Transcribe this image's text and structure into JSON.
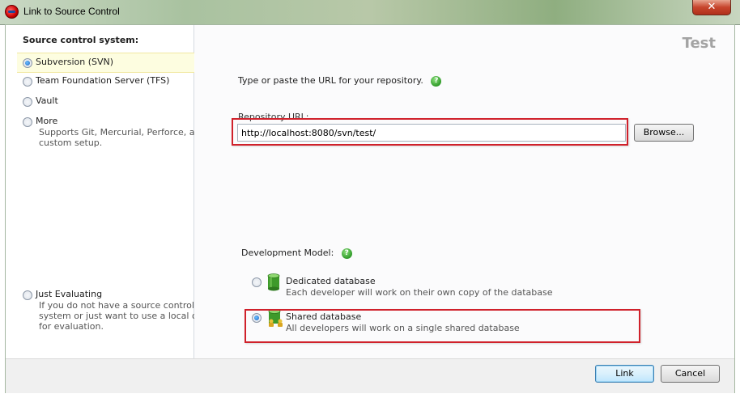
{
  "window": {
    "title": "Link to Source Control",
    "close_label": "✕"
  },
  "left": {
    "heading": "Source control system:",
    "options": [
      {
        "label": "Subversion (SVN)",
        "selected": true
      },
      {
        "label": "Team Foundation Server (TFS)",
        "selected": false
      },
      {
        "label": "Vault",
        "selected": false
      },
      {
        "label": "More",
        "desc_lines": [
          "Supports Git, Mercurial, Perforce, and",
          "custom setup."
        ],
        "selected": false
      },
      {
        "label": "Just Evaluating",
        "desc_lines": [
          "If you do not have a source control",
          "system or just want to use a local one",
          "for evaluation."
        ],
        "selected": false
      }
    ]
  },
  "right": {
    "page_title": "Test",
    "instruction": "Type or paste the URL for your repository.",
    "repo_label": "Repository URL:",
    "repo_url": "http://localhost:8080/svn/test/",
    "browse_label": "Browse...",
    "dev_model_label": "Development Model:",
    "models": [
      {
        "title": "Dedicated database",
        "desc": "Each developer will work on their own copy of the database",
        "selected": false
      },
      {
        "title": "Shared database",
        "desc": "All developers will work on a single shared database",
        "selected": true
      }
    ]
  },
  "footer": {
    "link_label": "Link",
    "cancel_label": "Cancel"
  },
  "colors": {
    "highlight_red": "#d0212b",
    "help_green": "#2f9a28",
    "selected_bg": "#fdfde0"
  },
  "icons": [
    "app-icon",
    "close-icon",
    "help-icon",
    "database-icon",
    "shared-database-icon"
  ]
}
